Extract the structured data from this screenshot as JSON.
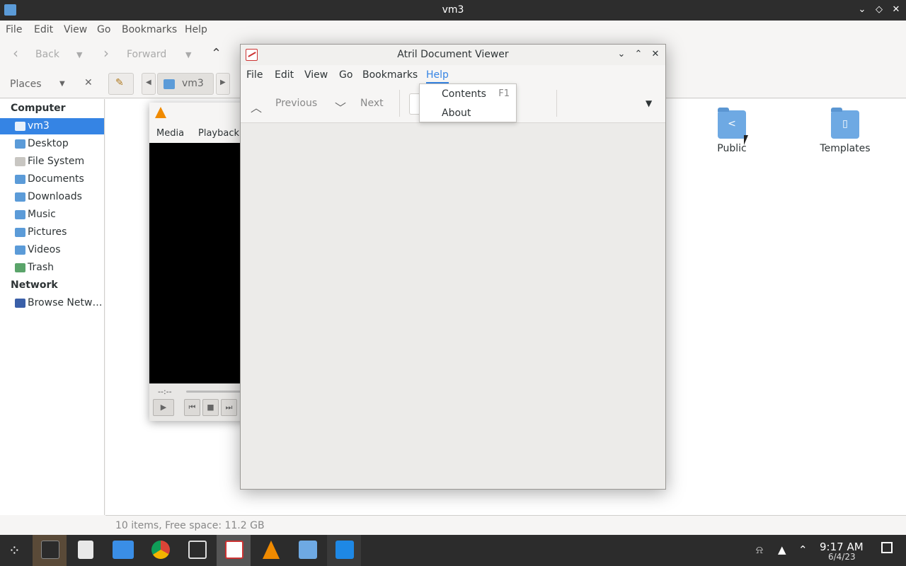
{
  "file_manager": {
    "title": "vm3",
    "menu": [
      "File",
      "Edit",
      "View",
      "Go",
      "Bookmarks",
      "Help"
    ],
    "toolbar": {
      "back": "Back",
      "forward": "Forward"
    },
    "places_label": "Places",
    "path": "vm3",
    "sidebar": {
      "computer_heading": "Computer",
      "items": [
        "vm3",
        "Desktop",
        "File System",
        "Documents",
        "Downloads",
        "Music",
        "Pictures",
        "Videos",
        "Trash"
      ],
      "network_heading": "Network",
      "network_items": [
        "Browse Netw…"
      ]
    },
    "folders": [
      {
        "label": "Public",
        "icon": "share-icon"
      },
      {
        "label": "Templates",
        "icon": "template-icon"
      }
    ],
    "status": "10 items, Free space: 11.2 GB"
  },
  "vlc": {
    "menu": [
      "Media",
      "Playback"
    ],
    "time": "--:--"
  },
  "atril": {
    "title": "Atril Document Viewer",
    "menu": [
      "File",
      "Edit",
      "View",
      "Go",
      "Bookmarks",
      "Help"
    ],
    "toolbar": {
      "previous": "Previous",
      "next": "Next"
    },
    "help_menu": {
      "items": [
        {
          "label": "Contents",
          "accel": "F1"
        },
        {
          "label": "About",
          "accel": ""
        }
      ]
    }
  },
  "taskbar": {
    "time": "9:17 AM",
    "date": "6/4/23",
    "apps": [
      "app-menu",
      "settings",
      "text-editor",
      "files",
      "chrome",
      "screenshot",
      "atril",
      "vlc",
      "file-manager",
      "vscode"
    ]
  },
  "colors": {
    "accent": "#3584e4",
    "titlebar_dark": "#2d2d2d",
    "taskbar": "#2c2c2c"
  }
}
